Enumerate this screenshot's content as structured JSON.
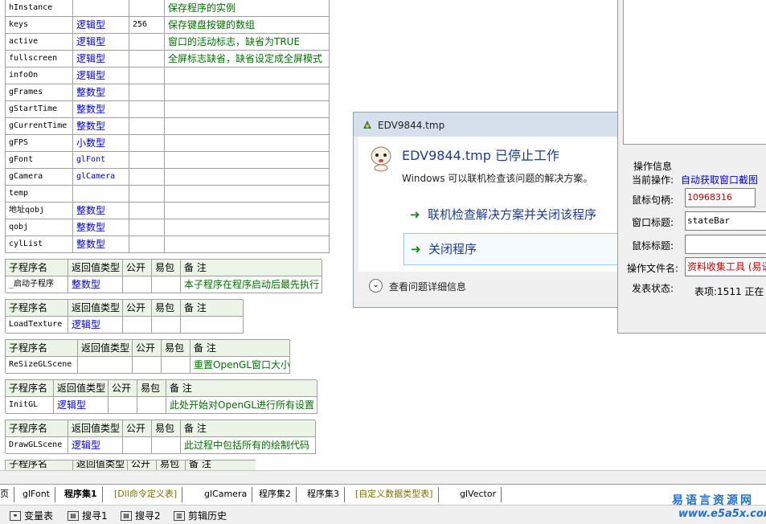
{
  "variables": [
    {
      "name": "hInstance",
      "type": "",
      "array": "",
      "note": "保存程序的实例"
    },
    {
      "name": "keys",
      "type": "逻辑型",
      "array": "256",
      "note": "保存键盘按键的数组"
    },
    {
      "name": "active",
      "type": "逻辑型",
      "array": "",
      "note": "窗口的活动标志，缺省为TRUE"
    },
    {
      "name": "fullscreen",
      "type": "逻辑型",
      "array": "",
      "note": "全屏标志缺省，缺省设定成全屏模式"
    },
    {
      "name": "infoOn",
      "type": "逻辑型",
      "array": "",
      "note": ""
    },
    {
      "name": "gFrames",
      "type": "整数型",
      "array": "",
      "note": ""
    },
    {
      "name": "gStartTime",
      "type": "整数型",
      "array": "",
      "note": ""
    },
    {
      "name": "gCurrentTime",
      "type": "整数型",
      "array": "",
      "note": ""
    },
    {
      "name": "gFPS",
      "type": "小数型",
      "array": "",
      "note": ""
    },
    {
      "name": "gFont",
      "type": "glFont",
      "array": "",
      "note": ""
    },
    {
      "name": "gCamera",
      "type": "glCamera",
      "array": "",
      "note": ""
    },
    {
      "name": "temp",
      "type": "",
      "array": "",
      "note": ""
    },
    {
      "name": "地址qobj",
      "type": "整数型",
      "array": "",
      "note": ""
    },
    {
      "name": "qobj",
      "type": "整数型",
      "array": "",
      "note": ""
    },
    {
      "name": "cylList",
      "type": "整数型",
      "array": "",
      "note": ""
    }
  ],
  "sub_headers": {
    "name": "子程序名",
    "ret": "返回值类型",
    "public": "公开",
    "pack": "易包",
    "note": "备 注"
  },
  "subprograms": [
    {
      "name": "_启动子程序",
      "ret": "整数型",
      "note": "本子程序在程序启动后最先执行"
    },
    {
      "name": "LoadTexture",
      "ret": "逻辑型",
      "note": ""
    },
    {
      "name": "ReSizeGLScene",
      "ret": "",
      "note": "重置OpenGL窗口大小"
    },
    {
      "name": "InitGL",
      "ret": "逻辑型",
      "note": "此处开始对OpenGL进行所有设置"
    },
    {
      "name": "DrawGLScene",
      "ret": "逻辑型",
      "note": "此过程中包括所有的绘制代码"
    }
  ],
  "dialog": {
    "title": "EDV9844.tmp",
    "heading": "EDV9844.tmp 已停止工作",
    "subtext": "Windows 可以联机检查该问题的解决方案。",
    "option1": "联机检查解决方案并关闭该程序",
    "option2": "关闭程序",
    "details": "查看问题详细信息"
  },
  "right_panel": {
    "group_title": "操作信息",
    "current_op_label": "当前操作:",
    "current_op_value": "自动获取窗口截图",
    "mouse_handle_label": "鼠标句柄:",
    "mouse_handle_value": "10968316",
    "window_title_label": "窗口标题:",
    "window_title_value": "stateBar",
    "mouse_title_label": "鼠标标题:",
    "mouse_title_value": "",
    "op_file_label": "操作文件名:",
    "op_file_value": "资料收集工具 (易语",
    "status_label": "发表状态:",
    "status_value": "表项:1511  正在"
  },
  "tabs": [
    {
      "label": "页",
      "style": "normal"
    },
    {
      "label": "glFont",
      "style": "normal"
    },
    {
      "label": "程序集1",
      "style": "active"
    },
    {
      "label": "[Dll命令定义表]",
      "style": "olive"
    },
    {
      "label": "glCamera",
      "style": "normal"
    },
    {
      "label": "程序集2",
      "style": "normal"
    },
    {
      "label": "程序集3",
      "style": "normal"
    },
    {
      "label": "[自定义数据类型表]",
      "style": "olive"
    },
    {
      "label": "glVector",
      "style": "normal"
    }
  ],
  "bottom_tools": [
    "变量表",
    "搜寻1",
    "搜寻2",
    "剪辑历史"
  ],
  "watermark": {
    "line1": "易语言资源网",
    "line2": "www.e5a5x.com"
  },
  "colors": {
    "type_blue": "#0000c0",
    "note_green": "#007000",
    "dialog_heading": "#1e3c8c",
    "red_value": "#c00000",
    "watermark": "#1f6fd0"
  }
}
